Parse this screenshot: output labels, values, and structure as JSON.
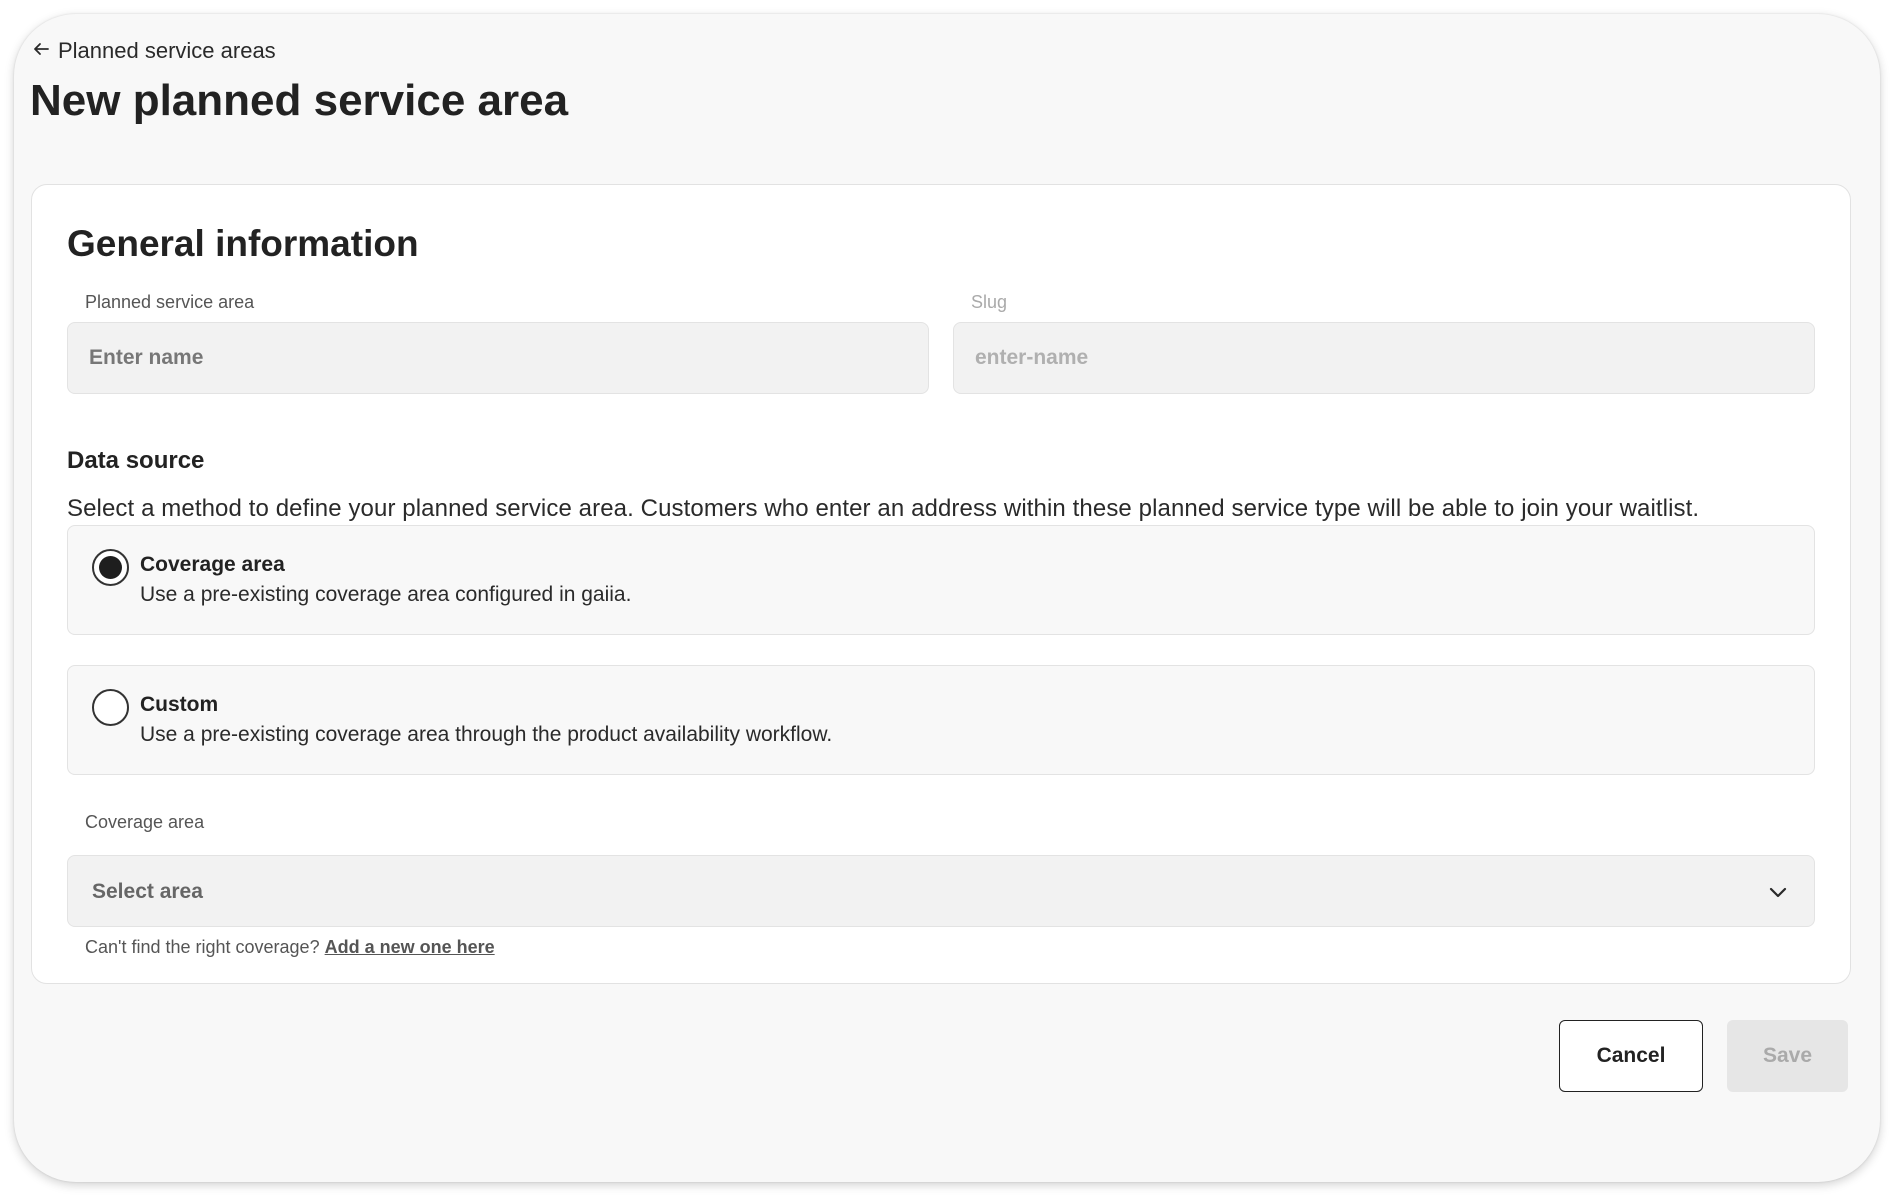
{
  "header": {
    "back_label": "Planned service areas",
    "title": "New planned service area"
  },
  "general": {
    "heading": "General information",
    "name_label": "Planned service area",
    "name_placeholder": "Enter name",
    "slug_label": "Slug",
    "slug_placeholder": "enter-name"
  },
  "data_source": {
    "heading": "Data source",
    "description": "Select a method to define your planned service area. Customers who enter an address within these planned service type will be able to join your waitlist.",
    "options": [
      {
        "title": "Coverage area",
        "description": "Use a pre-existing coverage area configured in gaiia.",
        "selected": true
      },
      {
        "title": "Custom",
        "description": "Use a pre-existing coverage area through the product availability workflow.",
        "selected": false
      }
    ]
  },
  "coverage": {
    "label": "Coverage area",
    "placeholder": "Select area",
    "helper_text": "Can't find the right coverage?",
    "helper_link": "Add a new one here"
  },
  "actions": {
    "cancel_label": "Cancel",
    "save_label": "Save",
    "save_disabled": true
  },
  "icons": {
    "back": "arrow-left-icon",
    "dropdown": "chevron-down-icon"
  }
}
